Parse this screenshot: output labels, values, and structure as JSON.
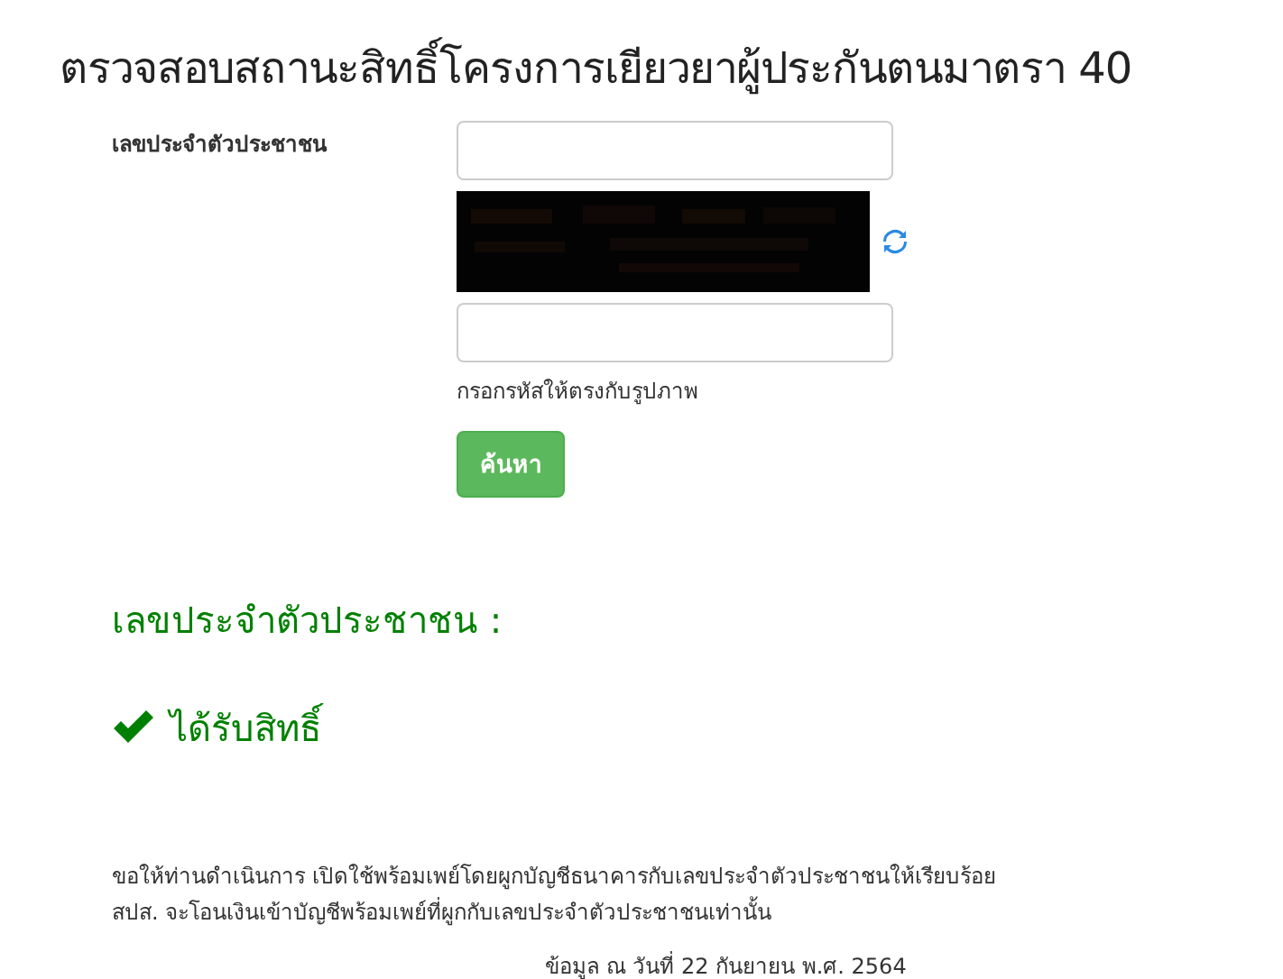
{
  "title": "ตรวจสอบสถานะสิทธิ์โครงการเยียวยาผู้ประกันตนมาตรา 40",
  "form": {
    "id_label": "เลขประจำตัวประชาชน",
    "captcha_hint": "กรอกรหัสให้ตรงกับรูปภาพ",
    "submit": "ค้นหา"
  },
  "result": {
    "heading": "เลขประจำตัวประชาชน :",
    "eligible": true,
    "status": "ได้รับสิทธิ์"
  },
  "notice": [
    "ขอให้ท่านดำเนินการ เปิดใช้พร้อมเพย์โดยผูกบัญชีธนาคารกับเลขประจำตัวประชาชนให้เรียบร้อย",
    "สปส. จะโอนเงินเข้าบัญชีพร้อมเพย์ที่ผูกกับเลขประจำตัวประชาชนเท่านั้น"
  ],
  "data_date": "ข้อมูล ณ วันที่ 22 กันยายน พ.ศ. 2564"
}
